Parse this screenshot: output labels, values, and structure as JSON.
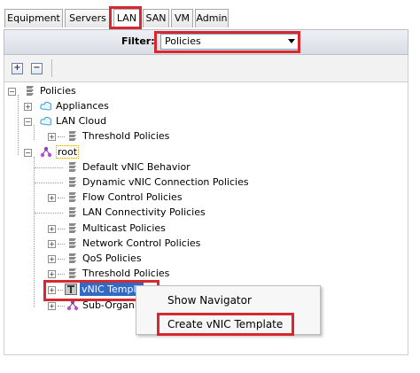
{
  "tabs": [
    "Equipment",
    "Servers",
    "LAN",
    "SAN",
    "VM",
    "Admin"
  ],
  "active_tab": "LAN",
  "filter": {
    "label": "Filter:",
    "value": "Policies"
  },
  "toolbar": {
    "expand_symbol": "+",
    "collapse_symbol": "−"
  },
  "tree": {
    "root_label": "Policies",
    "appliances": "Appliances",
    "lan_cloud": "LAN Cloud",
    "lan_cloud_threshold": "Threshold Policies",
    "root_org": "root",
    "items": [
      "Default vNIC Behavior",
      "Dynamic vNIC Connection Policies",
      "Flow Control Policies",
      "LAN Connectivity Policies",
      "Multicast Policies",
      "Network Control Policies",
      "QoS Policies",
      "Threshold Policies"
    ],
    "vnic_templates": "vNIC Templa",
    "sub_orgs": "Sub-Organiz"
  },
  "context_menu": {
    "items": [
      "Show Navigator",
      "Create vNIC Template"
    ]
  },
  "colors": {
    "highlight": "#d7282f",
    "selection": "#316ac5"
  }
}
